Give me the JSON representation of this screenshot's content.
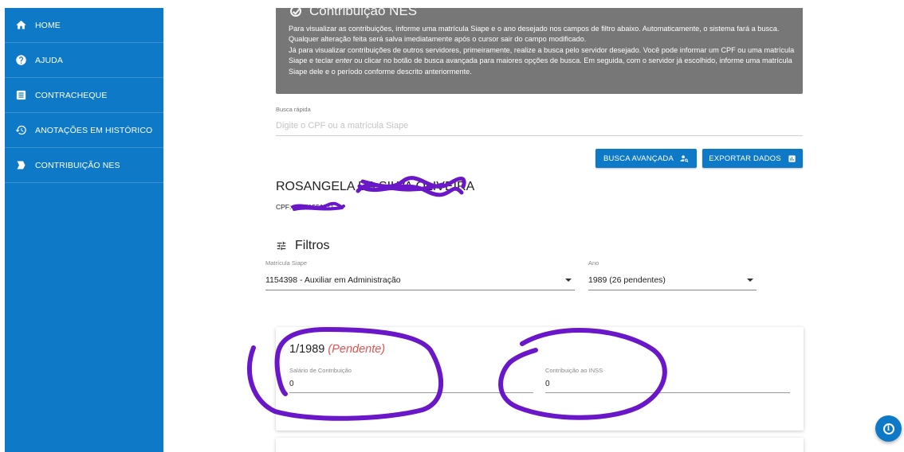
{
  "sidebar": {
    "items": [
      {
        "label": "HOME",
        "icon": "home-icon"
      },
      {
        "label": "AJUDA",
        "icon": "help-icon"
      },
      {
        "label": "CONTRACHEQUE",
        "icon": "document-icon"
      },
      {
        "label": "ANOTAÇÕES EM HISTÓRICO",
        "icon": "history-icon"
      },
      {
        "label": "CONTRIBUIÇÃO NES",
        "icon": "send-icon"
      }
    ]
  },
  "info": {
    "title": "Contribuição NES",
    "paragraph1": "Para visualizar as contribuições, informe uma matrícula Siape e o ano desejado nos campos de filtro abaixo. Automaticamente, o sistema fará a busca. Qualquer alteração feita será salva imediatamente após o cursor sair do campo modificado.",
    "paragraph2a": "Já para visualizar contribuições de outros servidores, primeiramente, realize a busca pelo servidor desejado. Você pode informar um CPF ou uma matrícula Siape e teclar ",
    "paragraph2_em": "enter",
    "paragraph2b": " ou clicar no botão de busca avançada para maiores opções de busca. Em seguida, com o servidor já escolhido, informe uma matrícula Siape dele e o período conforme descrito anteriormente."
  },
  "quick_search": {
    "label": "Busca rápida",
    "placeholder": "Digite o CPF ou a matrícula Siape",
    "value": ""
  },
  "buttons": {
    "advanced": "BUSCA AVANÇADA",
    "export": "EXPORTAR DADOS"
  },
  "person": {
    "name": "ROSANGELA DA SILVA OLIVEIRA",
    "cpf": "CPF: 01041551171"
  },
  "filters": {
    "title": "Filtros",
    "matricula_label": "Matrícula Siape",
    "matricula_value": "1154398 - Auxiliar em Administração",
    "ano_label": "Ano",
    "ano_value": "1989 (26 pendentes)"
  },
  "card": {
    "month": "1/1989",
    "status": "(Pendente)",
    "salario_label": "Salário de Contribuição",
    "salario_value": "0",
    "inss_label": "Contribuição ao INSS",
    "inss_value": "0"
  },
  "colors": {
    "primary": "#0d79c7",
    "info_bg": "#777777",
    "pending": "#e35151",
    "annotation": "#6a16c9"
  }
}
